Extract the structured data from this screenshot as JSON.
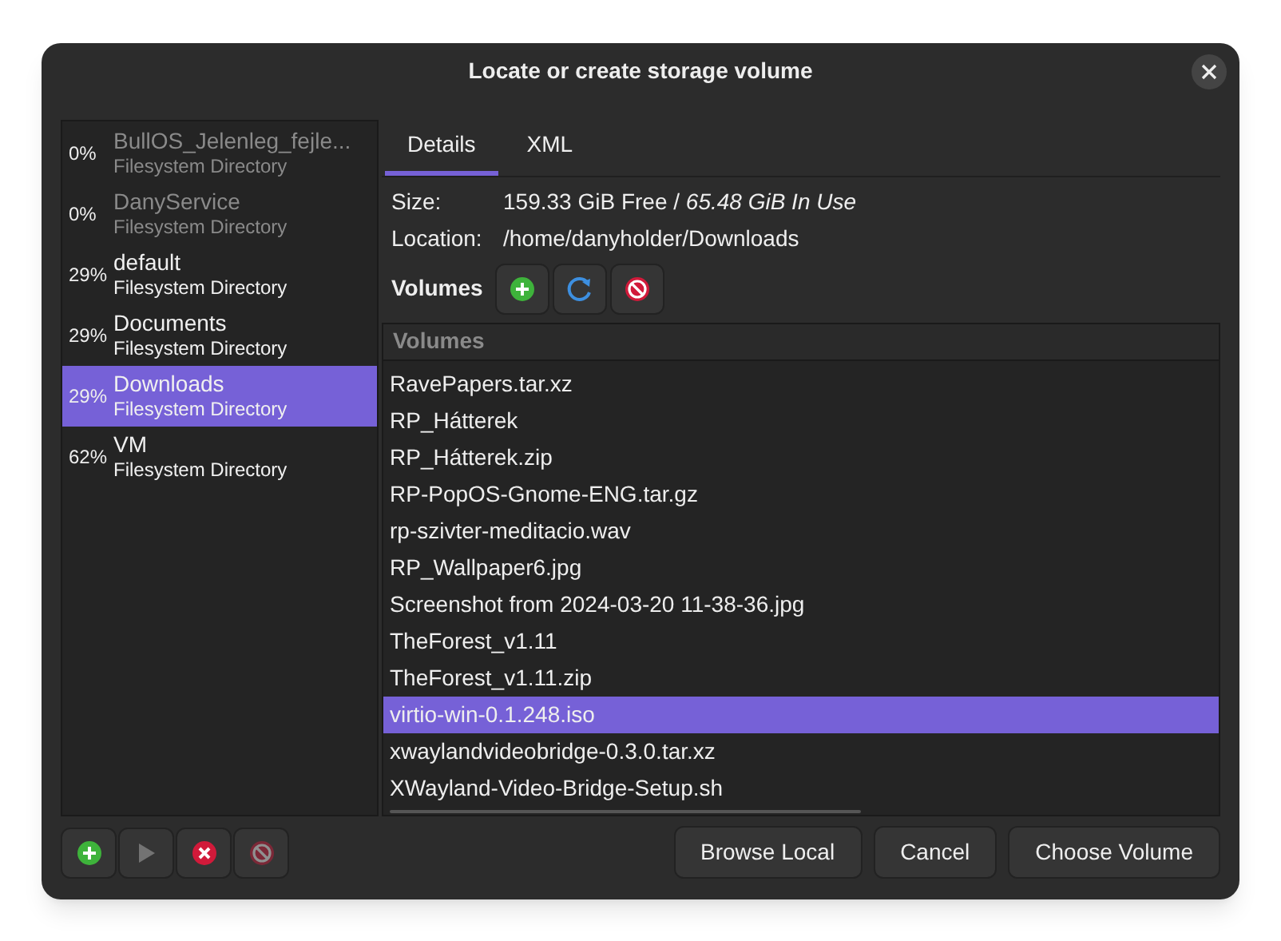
{
  "window": {
    "title": "Locate or create storage volume"
  },
  "pools": [
    {
      "usage": "0%",
      "name": "BullOS_Jelenleg_fejle...",
      "type": "Filesystem Directory",
      "active": false,
      "selected": false
    },
    {
      "usage": "0%",
      "name": "DanyService",
      "type": "Filesystem Directory",
      "active": false,
      "selected": false
    },
    {
      "usage": "29%",
      "name": "default",
      "type": "Filesystem Directory",
      "active": true,
      "selected": false
    },
    {
      "usage": "29%",
      "name": "Documents",
      "type": "Filesystem Directory",
      "active": true,
      "selected": false
    },
    {
      "usage": "29%",
      "name": "Downloads",
      "type": "Filesystem Directory",
      "active": true,
      "selected": true
    },
    {
      "usage": "62%",
      "name": "VM",
      "type": "Filesystem Directory",
      "active": true,
      "selected": false
    }
  ],
  "tabs": [
    {
      "label": "Details",
      "selected": true
    },
    {
      "label": "XML",
      "selected": false
    }
  ],
  "details": {
    "size_label": "Size:",
    "size_free": "159.33 GiB Free / ",
    "size_used": "65.48 GiB In Use",
    "location_label": "Location:",
    "location": "/home/danyholder/Downloads"
  },
  "volumes_label": "Volumes",
  "volume_buttons": [
    {
      "kind": "add",
      "disabled": false
    },
    {
      "kind": "refresh",
      "disabled": false
    },
    {
      "kind": "delete",
      "disabled": false
    }
  ],
  "volumes": {
    "header": "Volumes",
    "rows": [
      {
        "name": "RavePapers.tar.xz",
        "selected": false
      },
      {
        "name": "RP_Hátterek",
        "selected": false
      },
      {
        "name": "RP_Hátterek.zip",
        "selected": false
      },
      {
        "name": "RP-PopOS-Gnome-ENG.tar.gz",
        "selected": false
      },
      {
        "name": "rp-szivter-meditacio.wav",
        "selected": false
      },
      {
        "name": "RP_Wallpaper6.jpg",
        "selected": false
      },
      {
        "name": "Screenshot from 2024-03-20 11-38-36.jpg",
        "selected": false
      },
      {
        "name": "TheForest_v1.11",
        "selected": false
      },
      {
        "name": "TheForest_v1.11.zip",
        "selected": false
      },
      {
        "name": "virtio-win-0.1.248.iso",
        "selected": true
      },
      {
        "name": "xwaylandvideobridge-0.3.0.tar.xz",
        "selected": false
      },
      {
        "name": "XWayland-Video-Bridge-Setup.sh",
        "selected": false
      }
    ]
  },
  "pool_buttons": [
    {
      "kind": "add",
      "disabled": false
    },
    {
      "kind": "start",
      "disabled": true
    },
    {
      "kind": "stop",
      "disabled": false
    },
    {
      "kind": "delete",
      "disabled": true
    }
  ],
  "buttons": [
    "Browse Local",
    "Cancel",
    "Choose Volume"
  ]
}
